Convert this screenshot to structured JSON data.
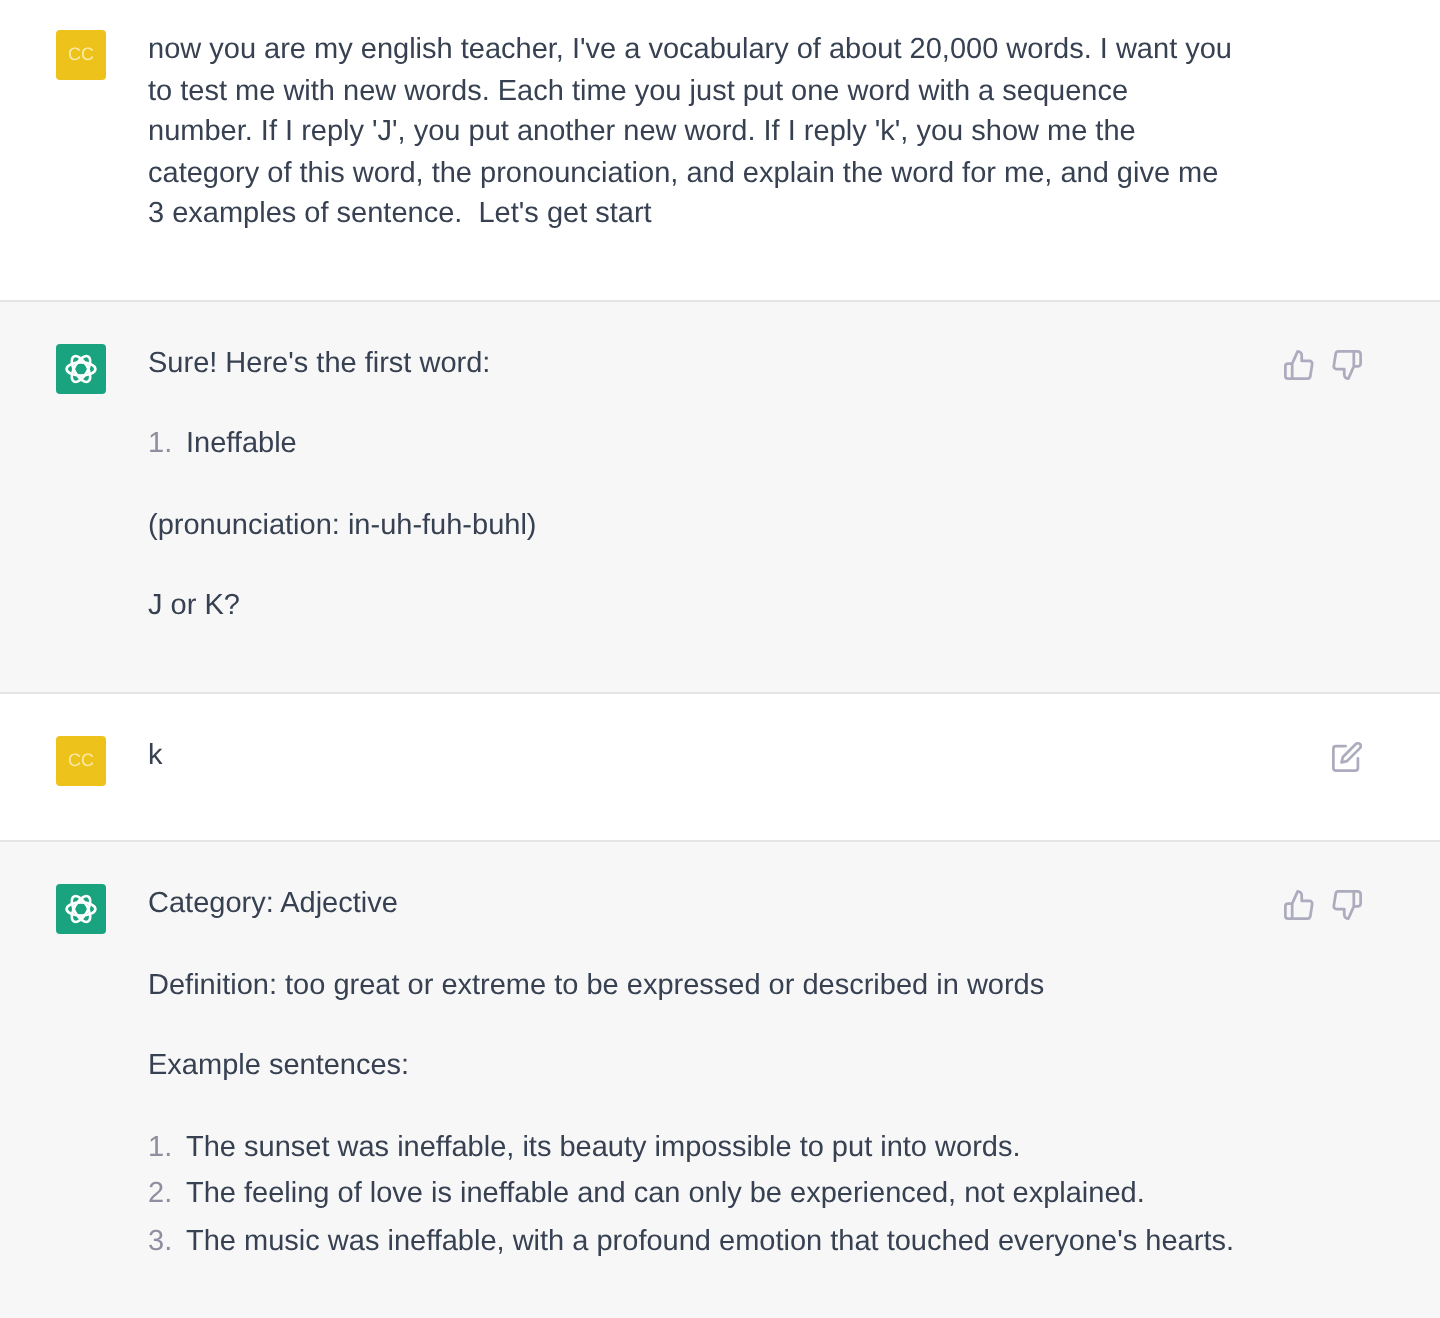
{
  "messages": [
    {
      "kind": "user",
      "avatar_text": "CC",
      "edit_button": false,
      "blocks": [
        {
          "kind": "paragraph",
          "text": "now you are my english teacher, I've a vocabulary of about 20,000 words. I want you to test me with new words. Each time you just put one word with a sequence number. If I reply 'J', you put another new word. If I reply 'k', you show me the category of this word, the pronounciation, and explain the word for me, and give me 3 examples of sentence.  Let's get start"
        }
      ]
    },
    {
      "kind": "assistant",
      "blocks": [
        {
          "kind": "paragraph",
          "text": "Sure! Here's the first word:"
        },
        {
          "kind": "list",
          "items": [
            {
              "number": "1.",
              "text": "Ineffable"
            }
          ]
        },
        {
          "kind": "paragraph",
          "text": "(pronunciation: in-uh-fuh-buhl)"
        },
        {
          "kind": "paragraph",
          "text": "J or K?"
        }
      ]
    },
    {
      "kind": "user",
      "avatar_text": "CC",
      "edit_button": true,
      "blocks": [
        {
          "kind": "paragraph",
          "text": "k"
        }
      ]
    },
    {
      "kind": "assistant",
      "blocks": [
        {
          "kind": "paragraph",
          "text": "Category: Adjective"
        },
        {
          "kind": "paragraph",
          "text": "Definition: too great or extreme to be expressed or described in words"
        },
        {
          "kind": "paragraph",
          "text": "Example sentences:"
        },
        {
          "kind": "list",
          "items": [
            {
              "number": "1.",
              "text": "The sunset was ineffable, its beauty impossible to put into words."
            },
            {
              "number": "2.",
              "text": "The feeling of love is ineffable and can only be experienced, not explained."
            },
            {
              "number": "3.",
              "text": "The music was ineffable, with a profound emotion that touched everyone's hearts."
            }
          ]
        }
      ]
    }
  ]
}
